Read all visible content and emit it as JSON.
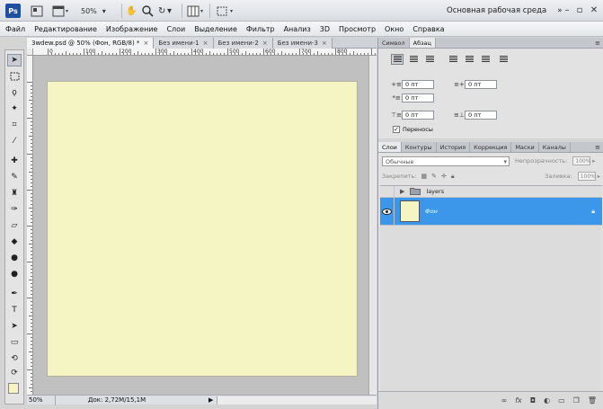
{
  "app": {
    "logo": "Ps",
    "zoom": "50%",
    "workspace": "Основная рабочая среда"
  },
  "menu": [
    "Файл",
    "Редактирование",
    "Изображение",
    "Слои",
    "Выделение",
    "Фильтр",
    "Анализ",
    "3D",
    "Просмотр",
    "Окно",
    "Справка"
  ],
  "doc_tabs": [
    {
      "label": "3wdew.psd @ 50% (Фон, RGB/8) *",
      "close": "×"
    },
    {
      "label": "Без имени-1",
      "close": "×"
    },
    {
      "label": "Без имени-2",
      "close": "×"
    },
    {
      "label": "Без имени-3",
      "close": "×"
    }
  ],
  "ruler_labels": [
    "0",
    "100",
    "200",
    "300",
    "400",
    "500",
    "600",
    "700",
    "800"
  ],
  "status": {
    "zoom": "50%",
    "doc_size": "Док: 2,72M/15,1M",
    "arrow": "▶"
  },
  "paragraph_panel": {
    "tabs": [
      "Символ",
      "Абзац"
    ],
    "fields": {
      "indent_left": "0 пт",
      "indent_right": "0 пт",
      "indent_first": "0 пт",
      "space_before": "0 пт",
      "space_after": "0 пт"
    },
    "hyphenation_label": "Переносы",
    "hyphenation_check": "✓"
  },
  "layers_panel": {
    "tabs": [
      "Слои",
      "Контуры",
      "История",
      "Коррекция",
      "Маски",
      "Каналы"
    ],
    "blend_mode": "Обычные",
    "opacity_label": "Непрозрачность:",
    "opacity_value": "100%",
    "lock_label": "Закрепить:",
    "fill_label": "Заливка:",
    "fill_value": "100%",
    "layers": [
      {
        "name": "layers",
        "type": "group"
      },
      {
        "name": "Фон",
        "type": "background",
        "selected": true
      }
    ]
  },
  "colors": {
    "canvas": "#f5f5c3",
    "selection": "#3c97ea"
  }
}
